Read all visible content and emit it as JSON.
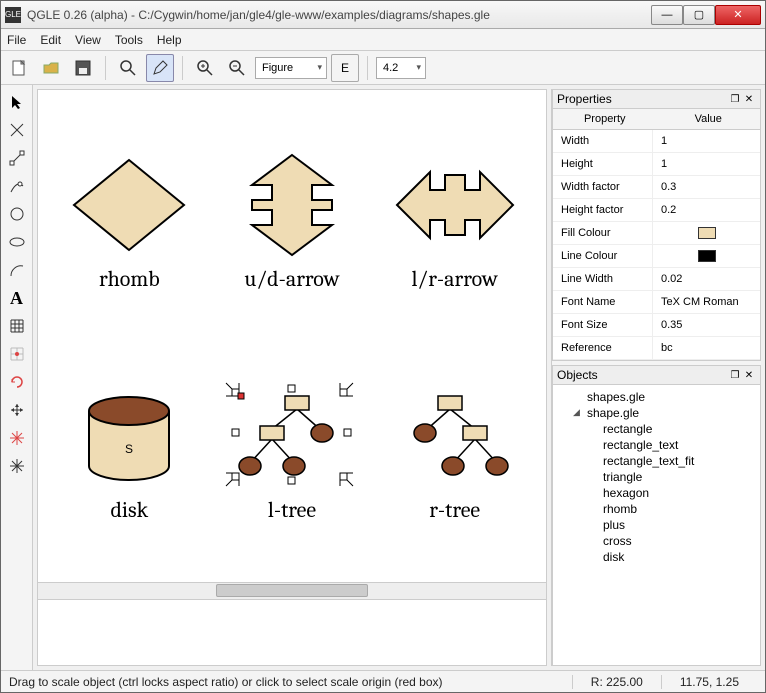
{
  "window": {
    "app_icon_text": "GLE",
    "title": "QGLE 0.26 (alpha) - C:/Cygwin/home/jan/gle4/gle-www/examples/diagrams/shapes.gle"
  },
  "menu": {
    "items": [
      "File",
      "Edit",
      "View",
      "Tools",
      "Help"
    ]
  },
  "toolbar": {
    "figure_combo": "Figure",
    "emf_btn": "E",
    "zoom_combo": "4.2"
  },
  "shapes": [
    {
      "label": "rhomb"
    },
    {
      "label": "u/d-arrow"
    },
    {
      "label": "l/r-arrow"
    },
    {
      "label": "disk",
      "letter": "S"
    },
    {
      "label": "l-tree"
    },
    {
      "label": "r-tree"
    }
  ],
  "properties": {
    "title": "Properties",
    "header_key": "Property",
    "header_val": "Value",
    "rows": [
      {
        "k": "Width",
        "v": "1"
      },
      {
        "k": "Height",
        "v": "1"
      },
      {
        "k": "Width factor",
        "v": "0.3"
      },
      {
        "k": "Height factor",
        "v": "0.2"
      },
      {
        "k": "Fill Colour",
        "color": "#efdcb4"
      },
      {
        "k": "Line Colour",
        "color": "#000000"
      },
      {
        "k": "Line Width",
        "v": "0.02"
      },
      {
        "k": "Font Name",
        "v": "TeX CM Roman"
      },
      {
        "k": "Font Size",
        "v": "0.35"
      },
      {
        "k": "Reference",
        "v": "bc"
      }
    ]
  },
  "objects": {
    "title": "Objects",
    "tree": [
      {
        "label": "shapes.gle",
        "lvl": 1
      },
      {
        "label": "shape.gle",
        "lvl": 1,
        "expanded": true
      },
      {
        "label": "rectangle",
        "lvl": 2
      },
      {
        "label": "rectangle_text",
        "lvl": 2
      },
      {
        "label": "rectangle_text_fit",
        "lvl": 2
      },
      {
        "label": "triangle",
        "lvl": 2
      },
      {
        "label": "hexagon",
        "lvl": 2
      },
      {
        "label": "rhomb",
        "lvl": 2
      },
      {
        "label": "plus",
        "lvl": 2
      },
      {
        "label": "cross",
        "lvl": 2
      },
      {
        "label": "disk",
        "lvl": 2
      }
    ]
  },
  "status": {
    "left": "Drag to scale object (ctrl locks aspect ratio) or click to select scale origin (red box)",
    "r": "R:  225.00",
    "coords": "11.75, 1.25"
  },
  "colors": {
    "fill": "#efdcb4",
    "brown": "#8a4a2a",
    "browndark": "#6d3a20"
  }
}
